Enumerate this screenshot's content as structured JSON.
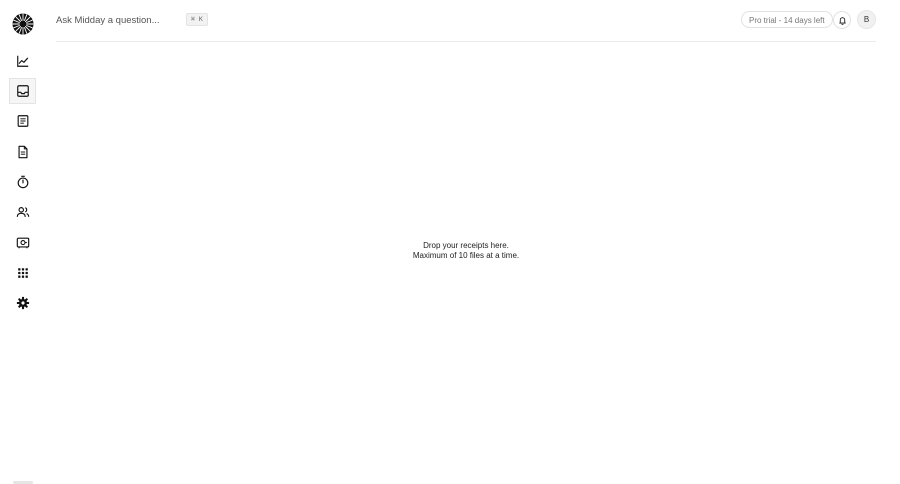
{
  "header": {
    "search_placeholder": "Ask Midday a question...",
    "shortcut": "⌘ K",
    "trial_label": "Pro trial - 14 days left",
    "avatar_initial": "B"
  },
  "sidebar": {
    "items": [
      {
        "icon": "chart-line-icon",
        "active": false
      },
      {
        "icon": "inbox-icon",
        "active": true
      },
      {
        "icon": "transactions-icon",
        "active": false
      },
      {
        "icon": "invoice-icon",
        "active": false
      },
      {
        "icon": "timer-icon",
        "active": false
      },
      {
        "icon": "customers-icon",
        "active": false
      },
      {
        "icon": "vault-icon",
        "active": false
      },
      {
        "icon": "apps-icon",
        "active": false
      },
      {
        "icon": "settings-gear-icon",
        "active": false
      }
    ]
  },
  "main": {
    "drop_title": "Drop your receipts here.",
    "drop_subtitle": "Maximum of 10 files at a time."
  },
  "colors": {
    "text": "#121212",
    "border": "#ececec",
    "muted": "#777777"
  }
}
